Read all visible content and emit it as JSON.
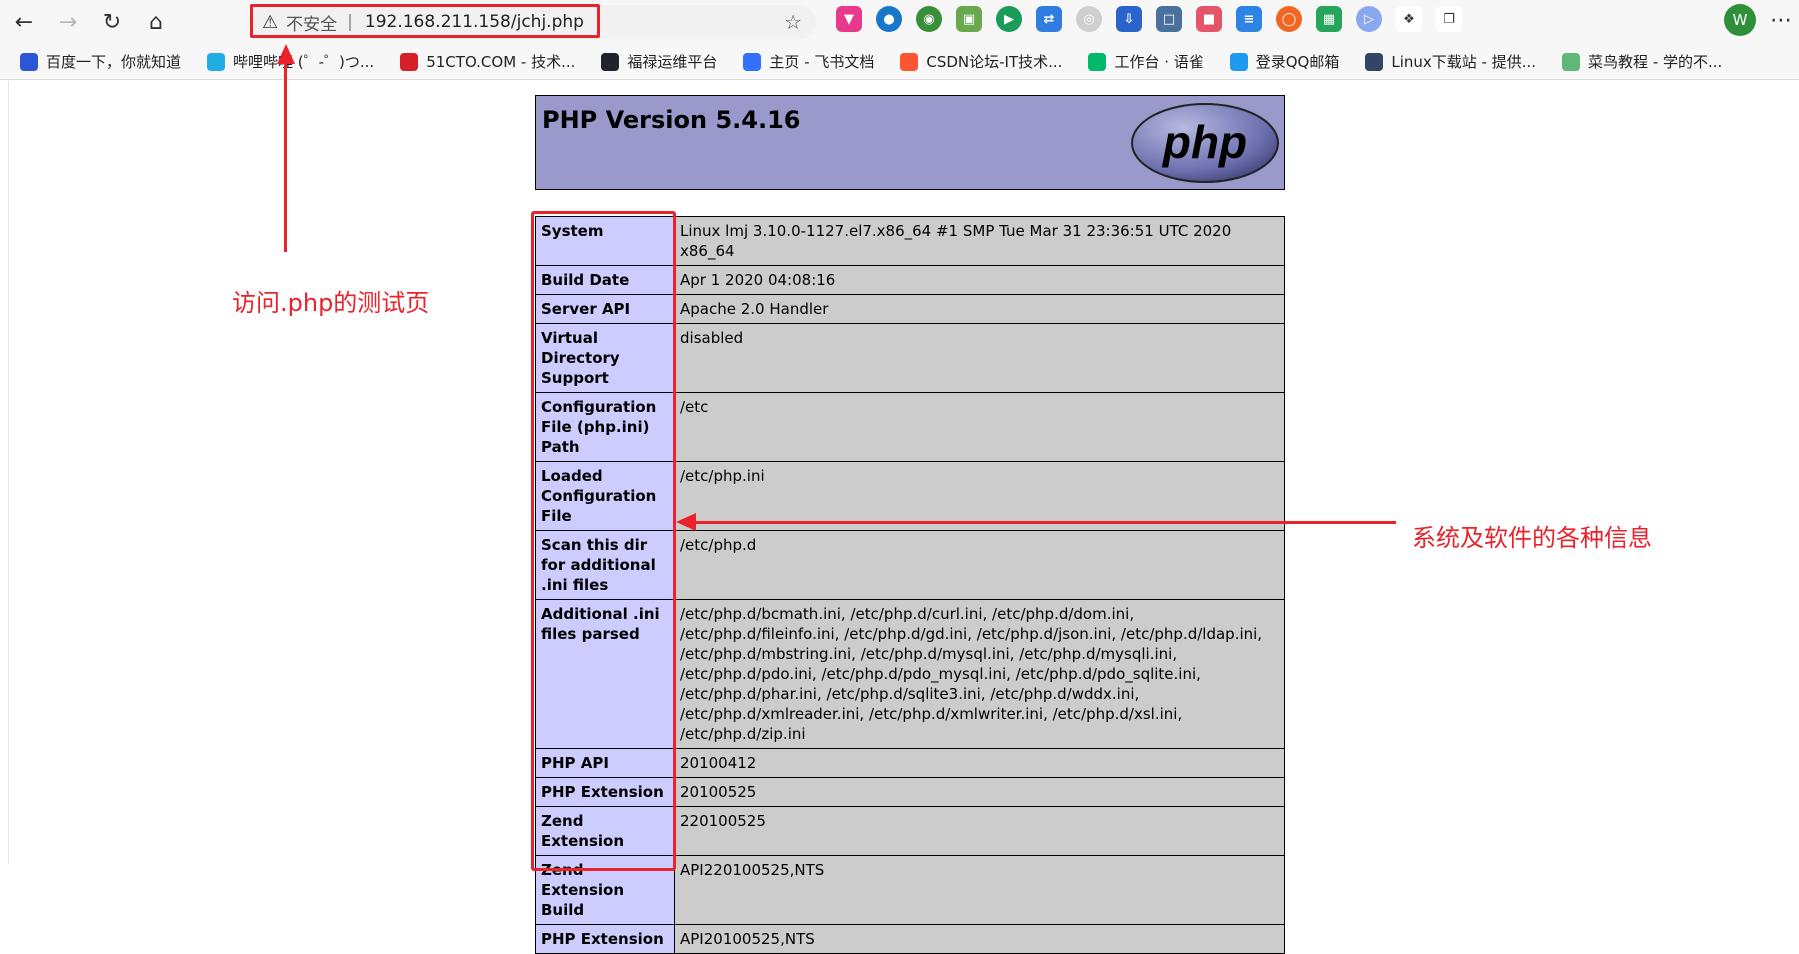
{
  "browser": {
    "address": {
      "security_label": "不安全",
      "separator": "|",
      "url": "192.168.211.158/jchj.php"
    },
    "profile_initial": "W"
  },
  "bookmarks": [
    {
      "label": "百度一下，你就知道",
      "color": "#2b57d6"
    },
    {
      "label": "哔哩哔哩 (゜-゜)つ...",
      "color": "#23ade5"
    },
    {
      "label": "51CTO.COM - 技术...",
      "color": "#d5202a"
    },
    {
      "label": "福禄运维平台",
      "color": "#20232a"
    },
    {
      "label": "主页 - 飞书文档",
      "color": "#3370ff"
    },
    {
      "label": "CSDN论坛-IT技术...",
      "color": "#fc5531"
    },
    {
      "label": "工作台 · 语雀",
      "color": "#00b96b"
    },
    {
      "label": "登录QQ邮箱",
      "color": "#1e9af0"
    },
    {
      "label": "Linux下载站 - 提供...",
      "color": "#334466"
    },
    {
      "label": "菜鸟教程 - 学的不...",
      "color": "#5fb878"
    }
  ],
  "phpinfo": {
    "title": "PHP Version 5.4.16",
    "logo_text": "php",
    "rows": [
      {
        "key": "System",
        "value": "Linux lmj 3.10.0-1127.el7.x86_64 #1 SMP Tue Mar 31 23:36:51 UTC 2020 x86_64"
      },
      {
        "key": "Build Date",
        "value": "Apr 1 2020 04:08:16"
      },
      {
        "key": "Server API",
        "value": "Apache 2.0 Handler"
      },
      {
        "key": "Virtual Directory Support",
        "value": "disabled"
      },
      {
        "key": "Configuration File (php.ini) Path",
        "value": "/etc"
      },
      {
        "key": "Loaded Configuration File",
        "value": "/etc/php.ini"
      },
      {
        "key": "Scan this dir for additional .ini files",
        "value": "/etc/php.d"
      },
      {
        "key": "Additional .ini files parsed",
        "value": "/etc/php.d/bcmath.ini, /etc/php.d/curl.ini, /etc/php.d/dom.ini, /etc/php.d/fileinfo.ini, /etc/php.d/gd.ini, /etc/php.d/json.ini, /etc/php.d/ldap.ini, /etc/php.d/mbstring.ini, /etc/php.d/mysql.ini, /etc/php.d/mysqli.ini, /etc/php.d/pdo.ini, /etc/php.d/pdo_mysql.ini, /etc/php.d/pdo_sqlite.ini, /etc/php.d/phar.ini, /etc/php.d/sqlite3.ini, /etc/php.d/wddx.ini, /etc/php.d/xmlreader.ini, /etc/php.d/xmlwriter.ini, /etc/php.d/xsl.ini, /etc/php.d/zip.ini"
      },
      {
        "key": "PHP API",
        "value": "20100412"
      },
      {
        "key": "PHP Extension",
        "value": "20100525"
      },
      {
        "key": "Zend Extension",
        "value": "220100525"
      },
      {
        "key": "Zend Extension Build",
        "value": "API220100525,NTS"
      },
      {
        "key": "PHP Extension",
        "value": "API20100525,NTS"
      }
    ]
  },
  "annotations": {
    "url_note": "访问.php的测试页",
    "info_note": "系统及软件的各种信息",
    "color": "#e8232b"
  }
}
